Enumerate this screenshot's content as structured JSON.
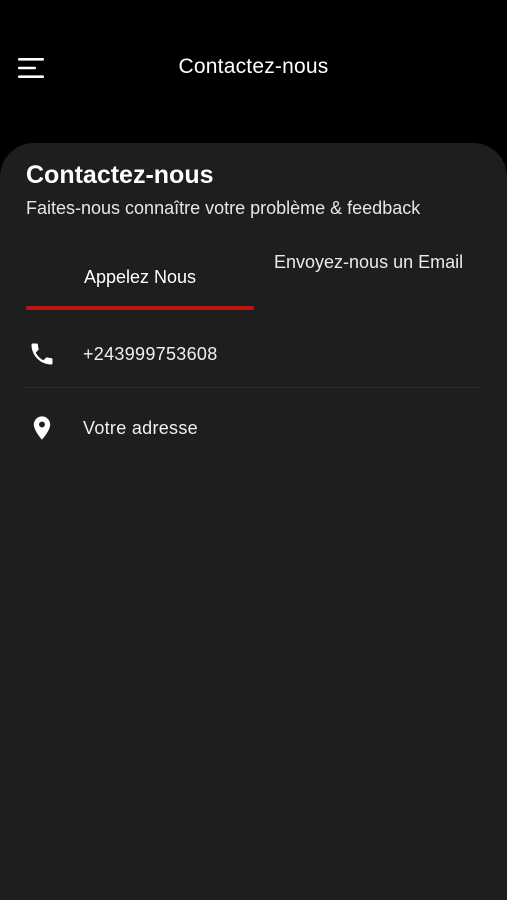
{
  "appbar": {
    "title": "Contactez-nous",
    "menu_icon": "hamburger-menu-icon"
  },
  "page": {
    "heading": "Contactez-nous",
    "subheading": "Faites-nous connaître votre problème & feedback"
  },
  "tabs": [
    {
      "label": "Appelez Nous",
      "selected": true
    },
    {
      "label": "Envoyez-nous un Email",
      "selected": false
    }
  ],
  "contact": {
    "phone": {
      "icon": "phone-icon",
      "value": "+243999753608"
    },
    "address": {
      "icon": "location-pin-icon",
      "value": "Votre adresse"
    }
  },
  "colors": {
    "background": "#000000",
    "sheet": "#1e1e1e",
    "accent": "#c21313",
    "text": "#ffffff"
  }
}
